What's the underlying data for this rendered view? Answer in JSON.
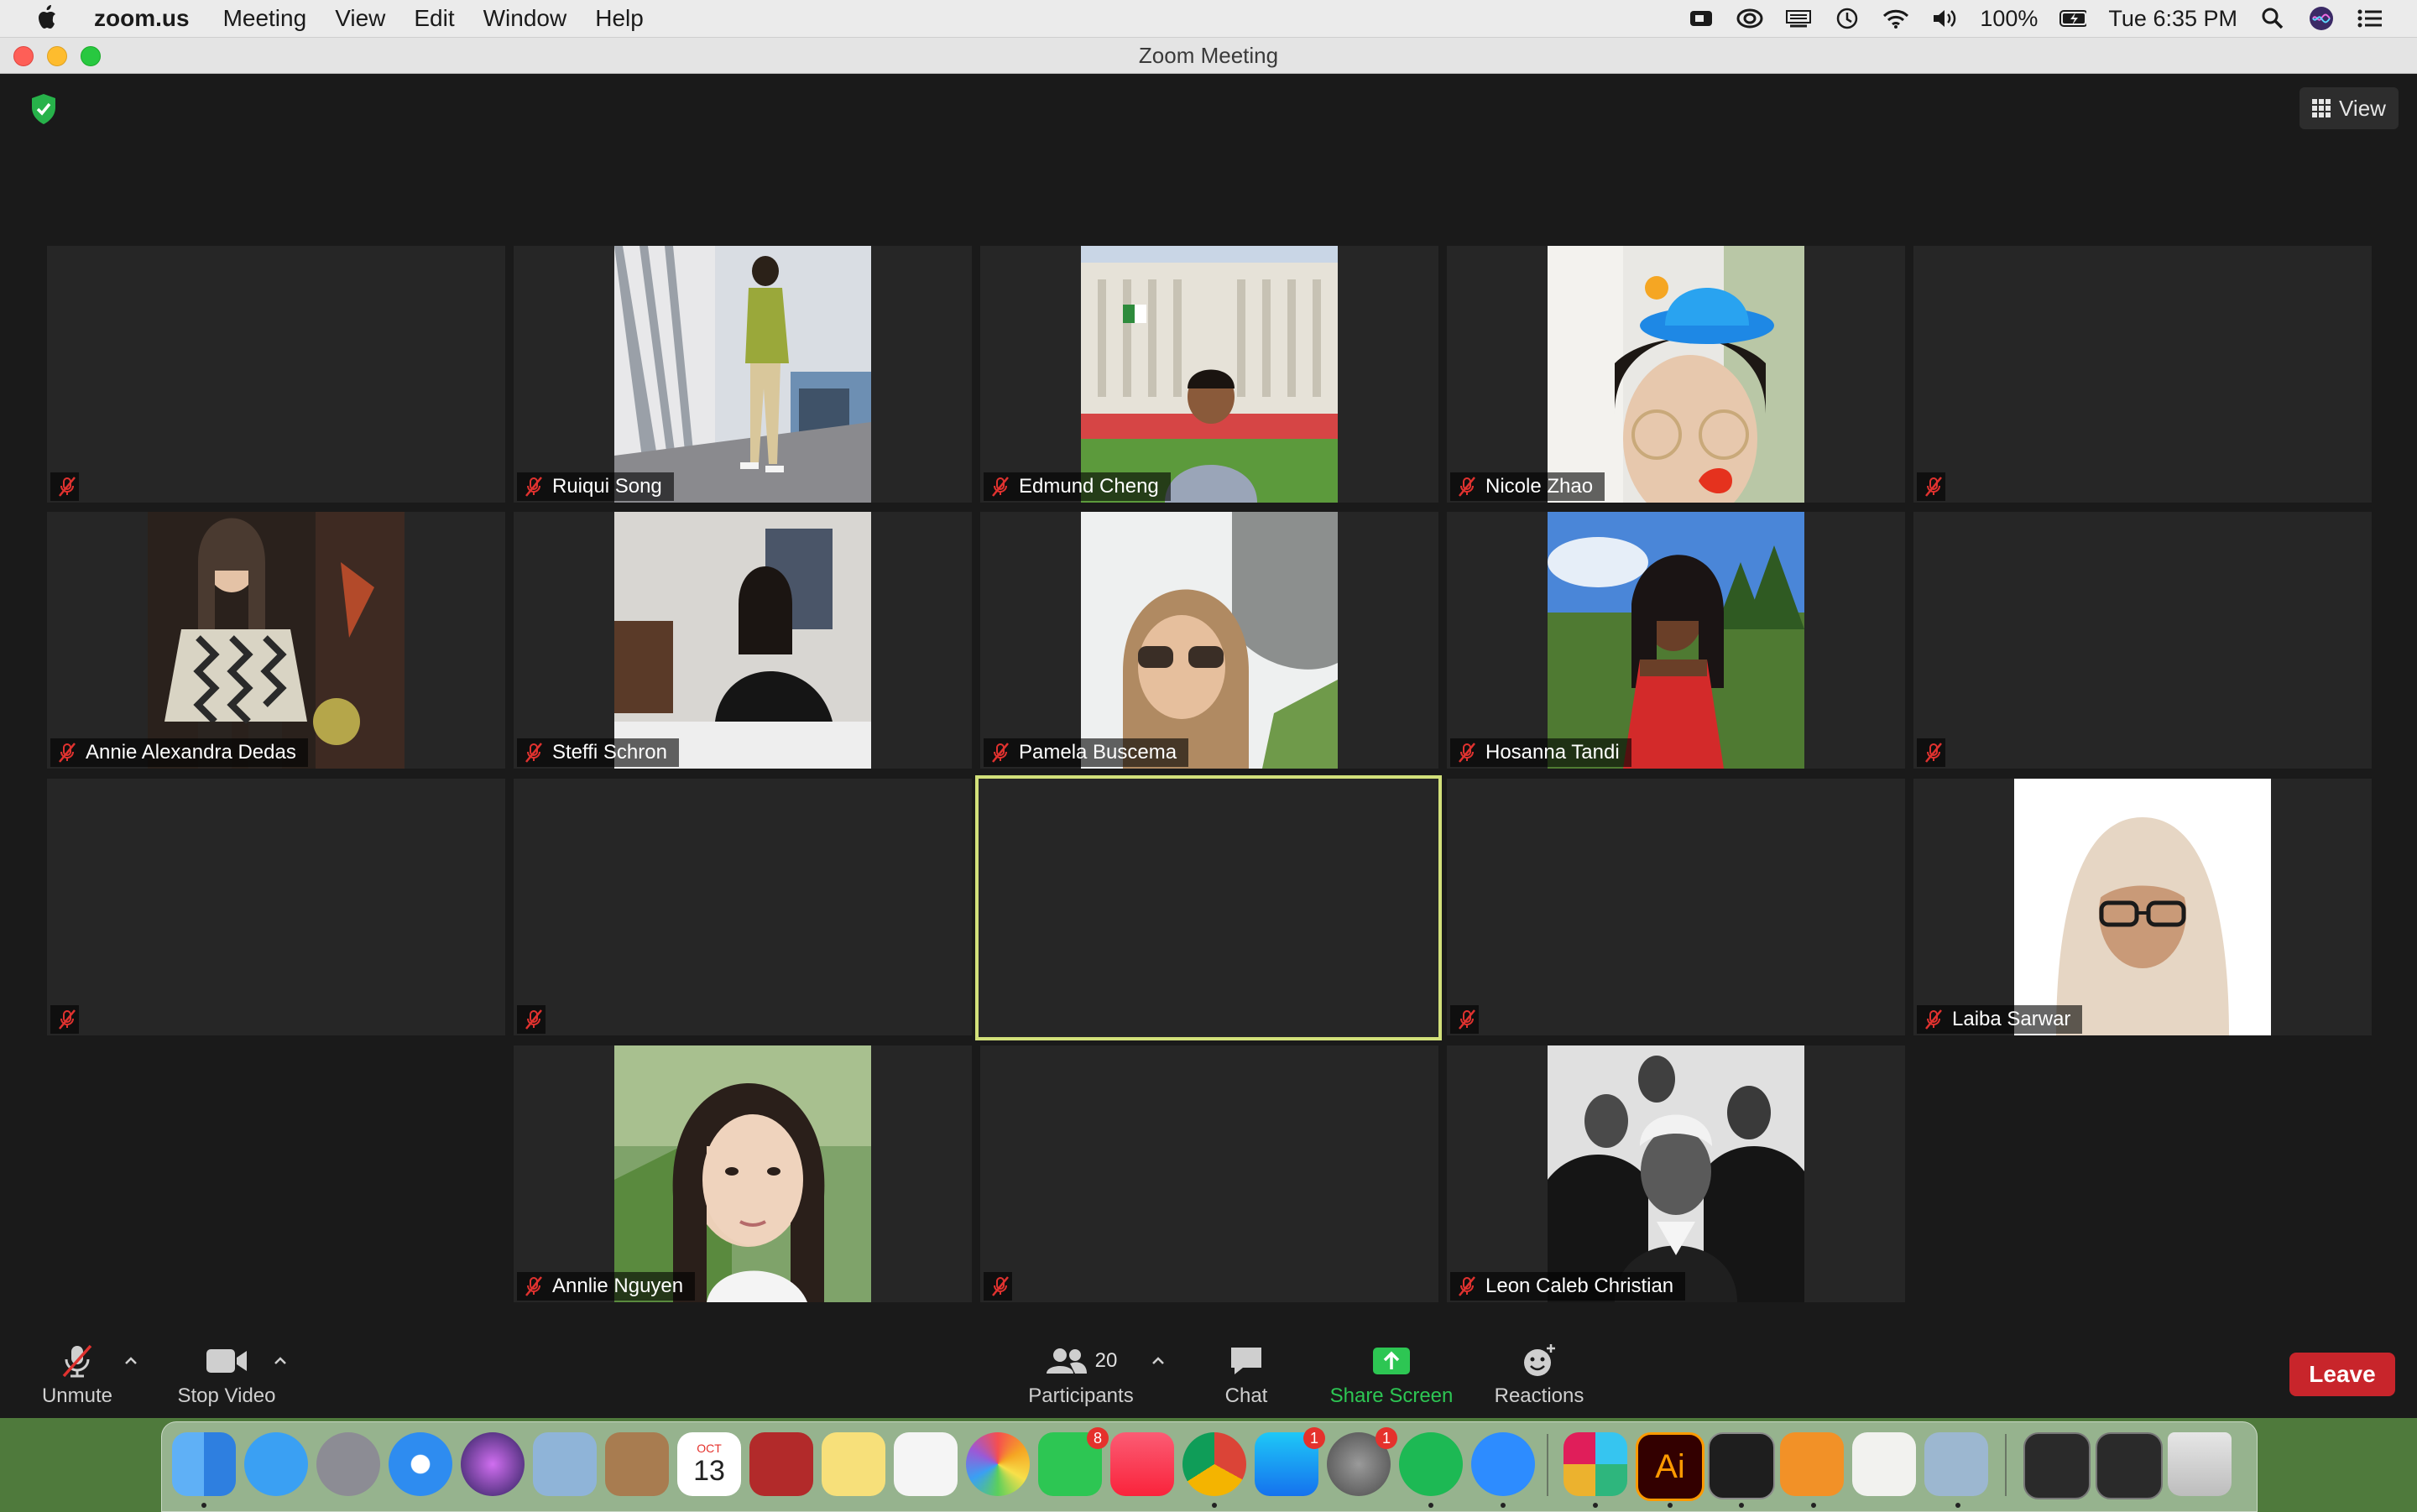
{
  "menubar": {
    "app_name": "zoom.us",
    "menus": [
      "Meeting",
      "View",
      "Edit",
      "Window",
      "Help"
    ],
    "battery": "100%",
    "clock": "Tue 6:35 PM"
  },
  "window": {
    "title": "Zoom Meeting"
  },
  "view_button": {
    "label": "View"
  },
  "participants_tiles": [
    {
      "name": "",
      "muted": true
    },
    {
      "name": "Ruiqui Song",
      "muted": true,
      "video": true
    },
    {
      "name": "Edmund Cheng",
      "muted": true,
      "video": true
    },
    {
      "name": "Nicole Zhao",
      "muted": true,
      "video": true
    },
    {
      "name": "",
      "muted": true
    },
    {
      "name": "Annie Alexandra Dedas",
      "muted": true,
      "video": true
    },
    {
      "name": "Steffi Schron",
      "muted": true,
      "video": true
    },
    {
      "name": "Pamela Buscema",
      "muted": true,
      "video": true
    },
    {
      "name": "Hosanna Tandi",
      "muted": true,
      "video": true
    },
    {
      "name": "",
      "muted": true
    },
    {
      "name": "",
      "muted": true
    },
    {
      "name": "",
      "muted": true
    },
    {
      "name": "",
      "muted": false,
      "active_speaker": true
    },
    {
      "name": "",
      "muted": true
    },
    {
      "name": "Laiba Sarwar",
      "muted": true,
      "video": true
    },
    {
      "name": "Annlie Nguyen",
      "muted": true,
      "video": true
    },
    {
      "name": "",
      "muted": true
    },
    {
      "name": "Leon Caleb Christian",
      "muted": true,
      "video": true
    }
  ],
  "toolbar": {
    "unmute_label": "Unmute",
    "stop_video_label": "Stop Video",
    "participants_label": "Participants",
    "participants_count": "20",
    "chat_label": "Chat",
    "share_label": "Share Screen",
    "reactions_label": "Reactions",
    "leave_label": "Leave"
  },
  "colors": {
    "active_speaker_border": "#d2e07a",
    "share_green": "#2dc653",
    "leave_red": "#c8252b",
    "mute_red": "#e0322f"
  },
  "dock": {
    "calendar_month": "OCT",
    "calendar_day": "13",
    "facetime_badge": "8",
    "appstore_badge": "1",
    "prefs_badge": "1",
    "illustrator_label": "Ai"
  }
}
